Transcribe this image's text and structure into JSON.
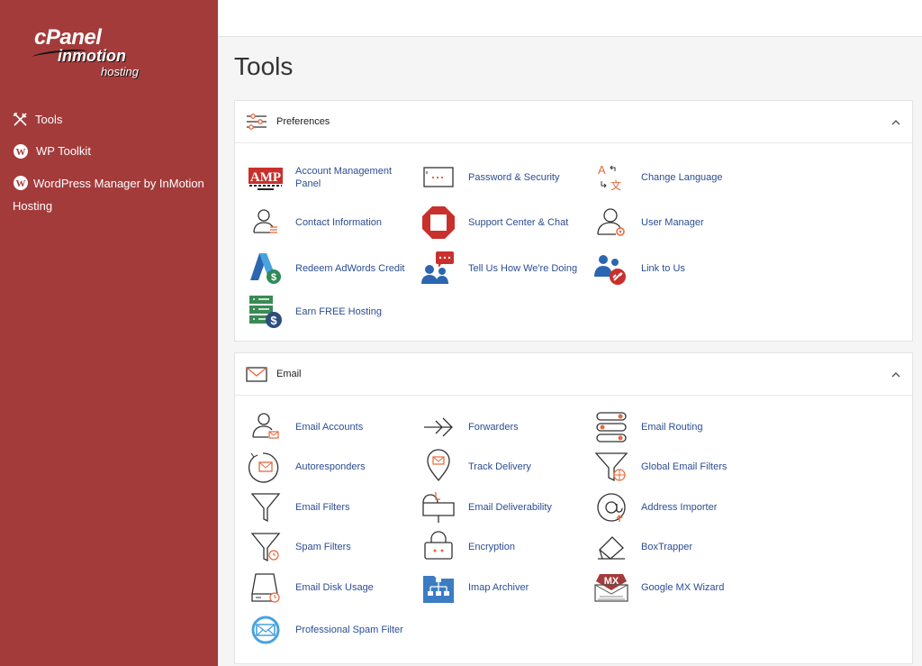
{
  "logo": {
    "cpanel": "cPanel",
    "inmotion": "inmotion",
    "hosting": "hosting"
  },
  "nav": [
    {
      "label": "Tools",
      "icon": "tools-icon"
    },
    {
      "label": "WP Toolkit",
      "icon": "wordpress-icon"
    },
    {
      "label": "WordPress Manager by InMotion Hosting",
      "icon": "wordpress-icon"
    }
  ],
  "page_title": "Tools",
  "preferences": {
    "title": "Preferences",
    "tools": [
      {
        "label": "Account Management Panel",
        "icon": "amp-icon"
      },
      {
        "label": "Password & Security",
        "icon": "password-icon"
      },
      {
        "label": "Change Language",
        "icon": "language-icon"
      },
      {
        "label": "Contact Information",
        "icon": "contact-icon"
      },
      {
        "label": "Support Center & Chat",
        "icon": "support-icon"
      },
      {
        "label": "User Manager",
        "icon": "user-manager-icon"
      },
      {
        "label": "Redeem AdWords Credit",
        "icon": "adwords-icon"
      },
      {
        "label": "Tell Us How We're Doing",
        "icon": "feedback-icon"
      },
      {
        "label": "Link to Us",
        "icon": "link-icon"
      },
      {
        "label": "Earn FREE Hosting",
        "icon": "hosting-icon"
      }
    ]
  },
  "email": {
    "title": "Email",
    "tools": [
      {
        "label": "Email Accounts",
        "icon": "email-accounts-icon"
      },
      {
        "label": "Forwarders",
        "icon": "forwarders-icon"
      },
      {
        "label": "Email Routing",
        "icon": "routing-icon"
      },
      {
        "label": "Autoresponders",
        "icon": "autoresponder-icon"
      },
      {
        "label": "Track Delivery",
        "icon": "track-icon"
      },
      {
        "label": "Global Email Filters",
        "icon": "global-filter-icon"
      },
      {
        "label": "Email Filters",
        "icon": "filter-icon"
      },
      {
        "label": "Email Deliverability",
        "icon": "deliverability-icon"
      },
      {
        "label": "Address Importer",
        "icon": "importer-icon"
      },
      {
        "label": "Spam Filters",
        "icon": "spam-filter-icon"
      },
      {
        "label": "Encryption",
        "icon": "encryption-icon"
      },
      {
        "label": "BoxTrapper",
        "icon": "boxtrapper-icon"
      },
      {
        "label": "Email Disk Usage",
        "icon": "disk-usage-icon"
      },
      {
        "label": "Imap Archiver",
        "icon": "archiver-icon"
      },
      {
        "label": "Google MX Wizard",
        "icon": "mx-icon"
      },
      {
        "label": "Professional Spam Filter",
        "icon": "pro-spam-icon"
      }
    ]
  },
  "colors": {
    "sidebar": "#a33b3b",
    "link": "#2b4d94",
    "accent": "#e8683a"
  }
}
